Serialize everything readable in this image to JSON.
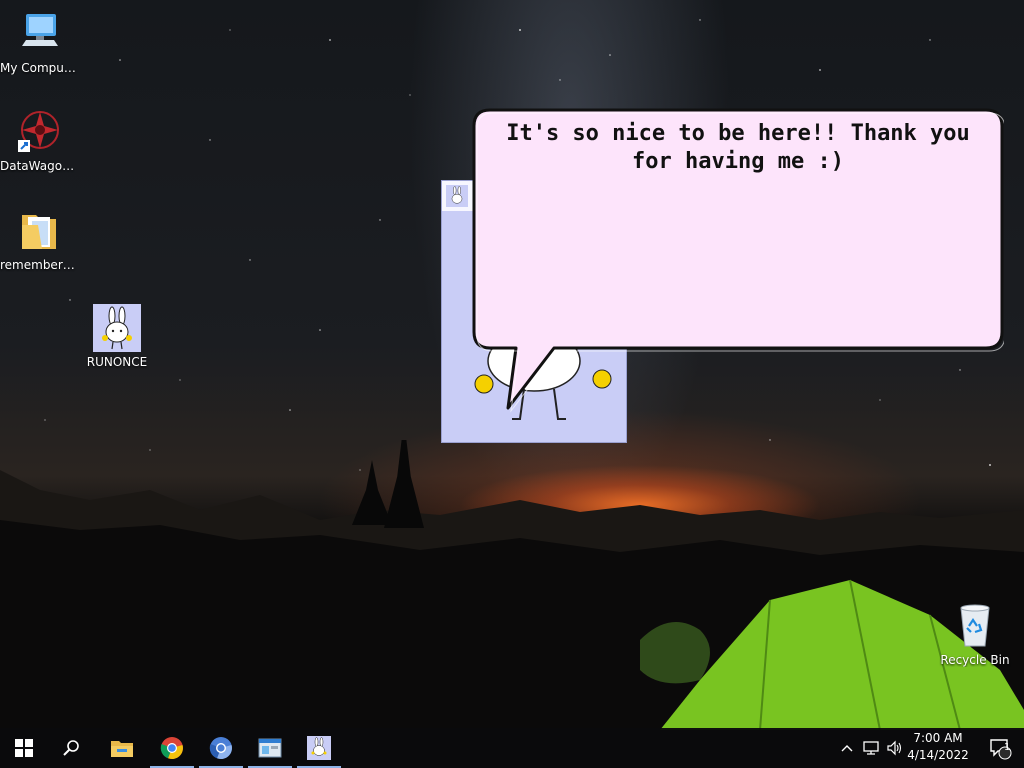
{
  "desktop": {
    "icons": [
      {
        "label": "My Computer",
        "icon": "computer-icon"
      },
      {
        "label": "DataWagon...",
        "icon": "datawagon-shortcut-icon"
      },
      {
        "label": "remember_...",
        "icon": "folder-icon"
      },
      {
        "label": "RUNONCE",
        "icon": "bunny-app-icon"
      },
      {
        "label": "Recycle Bin",
        "icon": "recycle-bin-icon"
      }
    ]
  },
  "pet": {
    "speech": "It's so nice to be here!! Thank you for having me :)",
    "bubble_color": "#fde4fb",
    "window_color": "#c9cdf6"
  },
  "taskbar": {
    "buttons": [
      "start-icon",
      "search-icon",
      "file-explorer-icon",
      "chrome-icon",
      "chromium-icon",
      "app-window-icon",
      "bunny-app-icon"
    ],
    "tray": [
      "chevron-up-icon",
      "network-icon",
      "volume-icon"
    ],
    "clock": {
      "time": "7:00 AM",
      "date": "4/14/2022"
    },
    "notifications_count": "1"
  }
}
